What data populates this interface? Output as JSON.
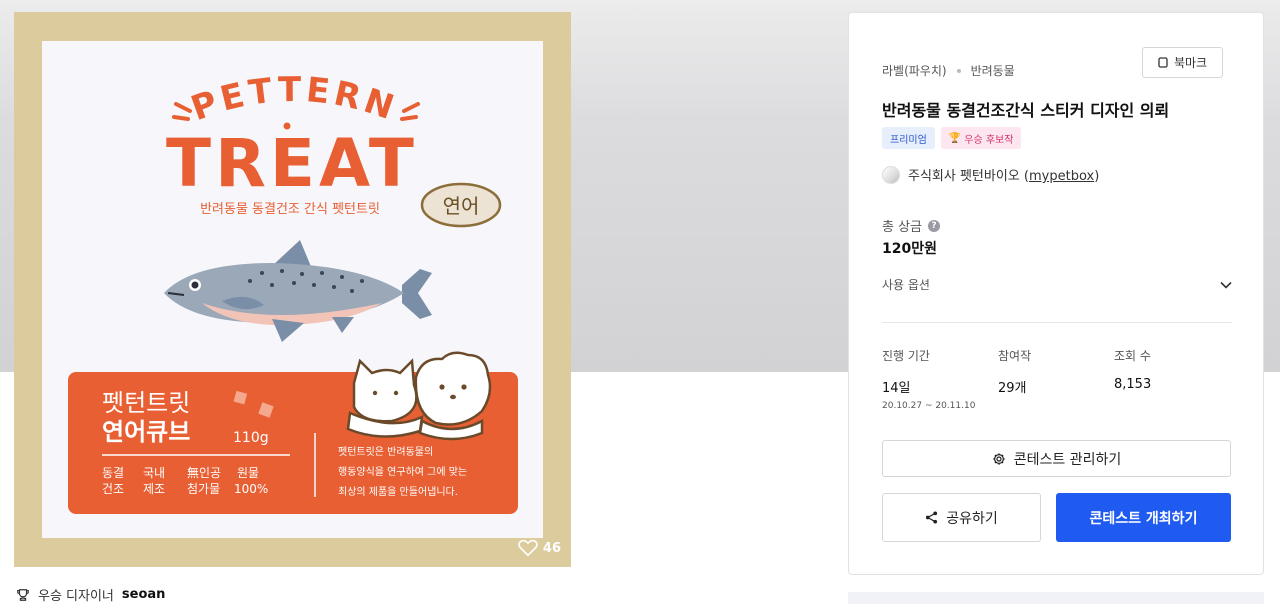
{
  "artwork": {
    "logo_top": "PETTERN",
    "logo_main": "TREAT",
    "tagline": "반려동물 동결건조 간식 펫턴트릿",
    "flavor_badge": "연어",
    "product_line1": "펫턴트릿",
    "product_line2": "연어큐브",
    "weight": "110g",
    "features": [
      {
        "top": "동결",
        "bottom": "건조"
      },
      {
        "top": "국내",
        "bottom": "제조"
      },
      {
        "top": "無인공",
        "bottom": "첨가물"
      },
      {
        "top": "원물",
        "bottom": "100%"
      }
    ],
    "description": [
      "펫턴트릿은 반려동물의",
      "행동양식을 연구하여 그에 맞는",
      "최상의 제품을 만들어냅니다."
    ],
    "likes": "46",
    "colors": {
      "frame": "#dccb9c",
      "orange": "#e85f33",
      "card": "#f7f7fb"
    }
  },
  "winner": {
    "label": "우승 디자이너",
    "name": "seoan"
  },
  "panel": {
    "breadcrumb": [
      "라벨(파우치)",
      "반려동물"
    ],
    "bookmark_label": "북마크",
    "title": "반려동물 동결건조간식 스티커 디자인 의뢰",
    "badges": {
      "premium": "프리미엄",
      "candidate": "우승 후보작"
    },
    "company": {
      "name": "주식회사 펫턴바이오 (",
      "handle": "mypetbox",
      "close": ")"
    },
    "prize_label": "총 상금",
    "prize_value": "120만원",
    "options_label": "사용 옵션",
    "stats": {
      "period": {
        "label": "진행 기간",
        "value": "14일",
        "range": "20.10.27 ~ 20.11.10"
      },
      "entries": {
        "label": "참여작",
        "value": "29개"
      },
      "views": {
        "label": "조회 수",
        "value": "8,153"
      }
    },
    "buttons": {
      "manage": "콘테스트 관리하기",
      "share": "공유하기",
      "host": "콘테스트 개최하기"
    },
    "accent_color": "#1f5bf1"
  }
}
